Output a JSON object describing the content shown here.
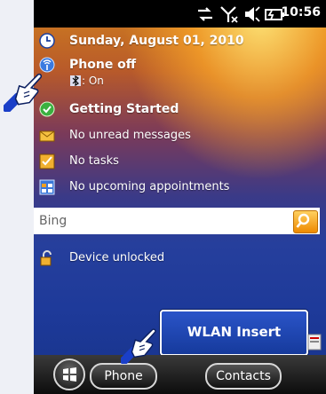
{
  "status_bar": {
    "time": "10:56",
    "icons": [
      "sync-icon",
      "antenna-off-icon",
      "volume-icon",
      "battery-icon"
    ]
  },
  "today": {
    "date": "Sunday, August 01, 2010",
    "phone_status": "Phone off",
    "bluetooth_status": ": On",
    "getting_started": "Getting Started",
    "messages": "No unread messages",
    "tasks": "No tasks",
    "appointments": "No upcoming appointments",
    "lock_status": "Device unlocked"
  },
  "search": {
    "value": "Bing"
  },
  "popup": {
    "label": "WLAN Insert"
  },
  "softkeys": {
    "left": "Phone",
    "right": "Contacts"
  },
  "colors": {
    "status_bar_bg": "#000000",
    "popup_bg": "#1e46b4",
    "hand_accent": "#1a3fc8"
  }
}
